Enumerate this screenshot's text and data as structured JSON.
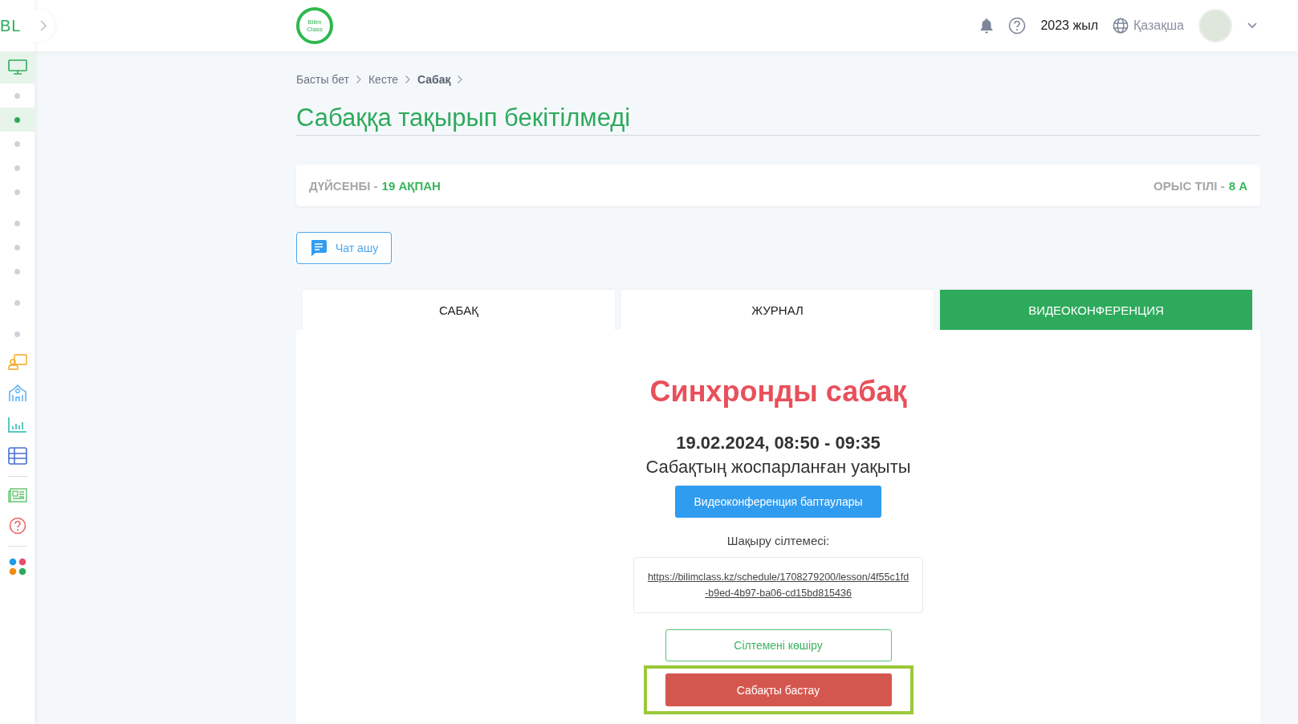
{
  "brand": {
    "mark": "BL",
    "logo_lines": [
      "Bilim",
      "Class"
    ]
  },
  "sidebar": {
    "main_item": {
      "selected": true
    },
    "sub_items": [
      {
        "selected": false
      },
      {
        "selected": true
      },
      {
        "selected": false
      },
      {
        "selected": false
      },
      {
        "selected": false
      },
      {
        "selected": false
      },
      {
        "selected": false
      },
      {
        "selected": false
      },
      {
        "selected": false
      },
      {
        "selected": false
      }
    ]
  },
  "header": {
    "year": "2023 жыл",
    "language": "Қазақша"
  },
  "breadcrumbs": [
    {
      "label": "Басты бет",
      "current": false
    },
    {
      "label": "Кесте",
      "current": false
    },
    {
      "label": "Сабақ",
      "current": true
    }
  ],
  "page_title": "Сабаққа тақырып бекітілмеді",
  "info_bar": {
    "day_label": "ДҮЙСЕНБІ -",
    "date": "19 АҚПАН",
    "subject_label": "ОРЫС ТІЛІ -",
    "class": "8 А"
  },
  "chat_button": "Чат ашу",
  "tabs": [
    {
      "label": "САБАҚ",
      "selected": false
    },
    {
      "label": "ЖУРНАЛ",
      "selected": false
    },
    {
      "label": "ВИДЕОКОНФЕРЕНЦИЯ",
      "selected": true
    }
  ],
  "conference": {
    "heading": "Синхронды сабақ",
    "datetime": "19.02.2024, 08:50 - 09:35",
    "datetime_caption": "Сабақтың жоспарланған уақыты",
    "settings_button": "Видеоконференция баптаулары",
    "invite_label": "Шақыру сілтемесі:",
    "invite_link": "https://bilimclass.kz/schedule/1708279200/lesson/4f55c1fd-b9ed-4b97-ba06-cd15bd815436",
    "copy_button": "Сілтемені көшіру",
    "start_button": "Сабақты бастау",
    "start_highlighted": true
  }
}
